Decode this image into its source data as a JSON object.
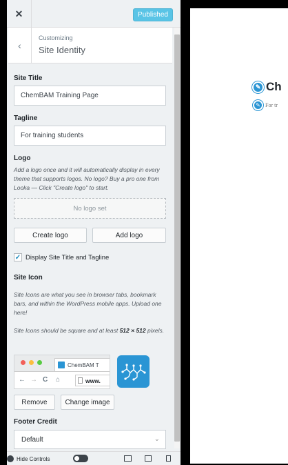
{
  "topbar": {
    "close_glyph": "✕",
    "publish_label": "Published"
  },
  "section": {
    "back_glyph": "‹",
    "customizing_label": "Customizing",
    "title": "Site Identity"
  },
  "fields": {
    "site_title_label": "Site Title",
    "site_title_value": "ChemBAM Training Page",
    "tagline_label": "Tagline",
    "tagline_value": "For training students"
  },
  "logo": {
    "label": "Logo",
    "description": "Add a logo once and it will automatically display in every theme that supports logos. No logo? Buy a pro one from Looka — Click \"Create logo\" to start.",
    "placeholder": "No logo set",
    "create_label": "Create logo",
    "add_label": "Add logo"
  },
  "display_title": {
    "checked": true,
    "check_glyph": "✓",
    "label": "Display Site Title and Tagline"
  },
  "site_icon": {
    "label": "Site Icon",
    "description_1": "Site Icons are what you see in browser tabs, bookmark bars, and within the WordPress mobile apps. Upload one here!",
    "description_2_prefix": "Site Icons should be square and at least ",
    "description_2_size": "512 × 512",
    "description_2_suffix": " pixels.",
    "preview_tab_title": "ChemBAM T",
    "preview_url": "www.",
    "remove_label": "Remove",
    "change_label": "Change image"
  },
  "footer_credit": {
    "label": "Footer Credit",
    "selected": "Default",
    "chevron": "⌄"
  },
  "footerbar": {
    "hide_controls_label": "Hide Controls"
  },
  "preview": {
    "site_title": "Ch",
    "tagline": "For tr",
    "pencil_glyph": "✎"
  },
  "colors": {
    "accent": "#2a95d4",
    "publish_bg": "#59c4e6",
    "panel_bg": "#eef1f3"
  },
  "icons": [
    "close-icon",
    "back-icon",
    "checkbox-check-icon",
    "safari-dots-icon",
    "site-icon-molecule",
    "chevron-down-icon",
    "hide-controls-icon",
    "desktop-icon",
    "tablet-icon",
    "mobile-icon",
    "pencil-edit-icon"
  ]
}
